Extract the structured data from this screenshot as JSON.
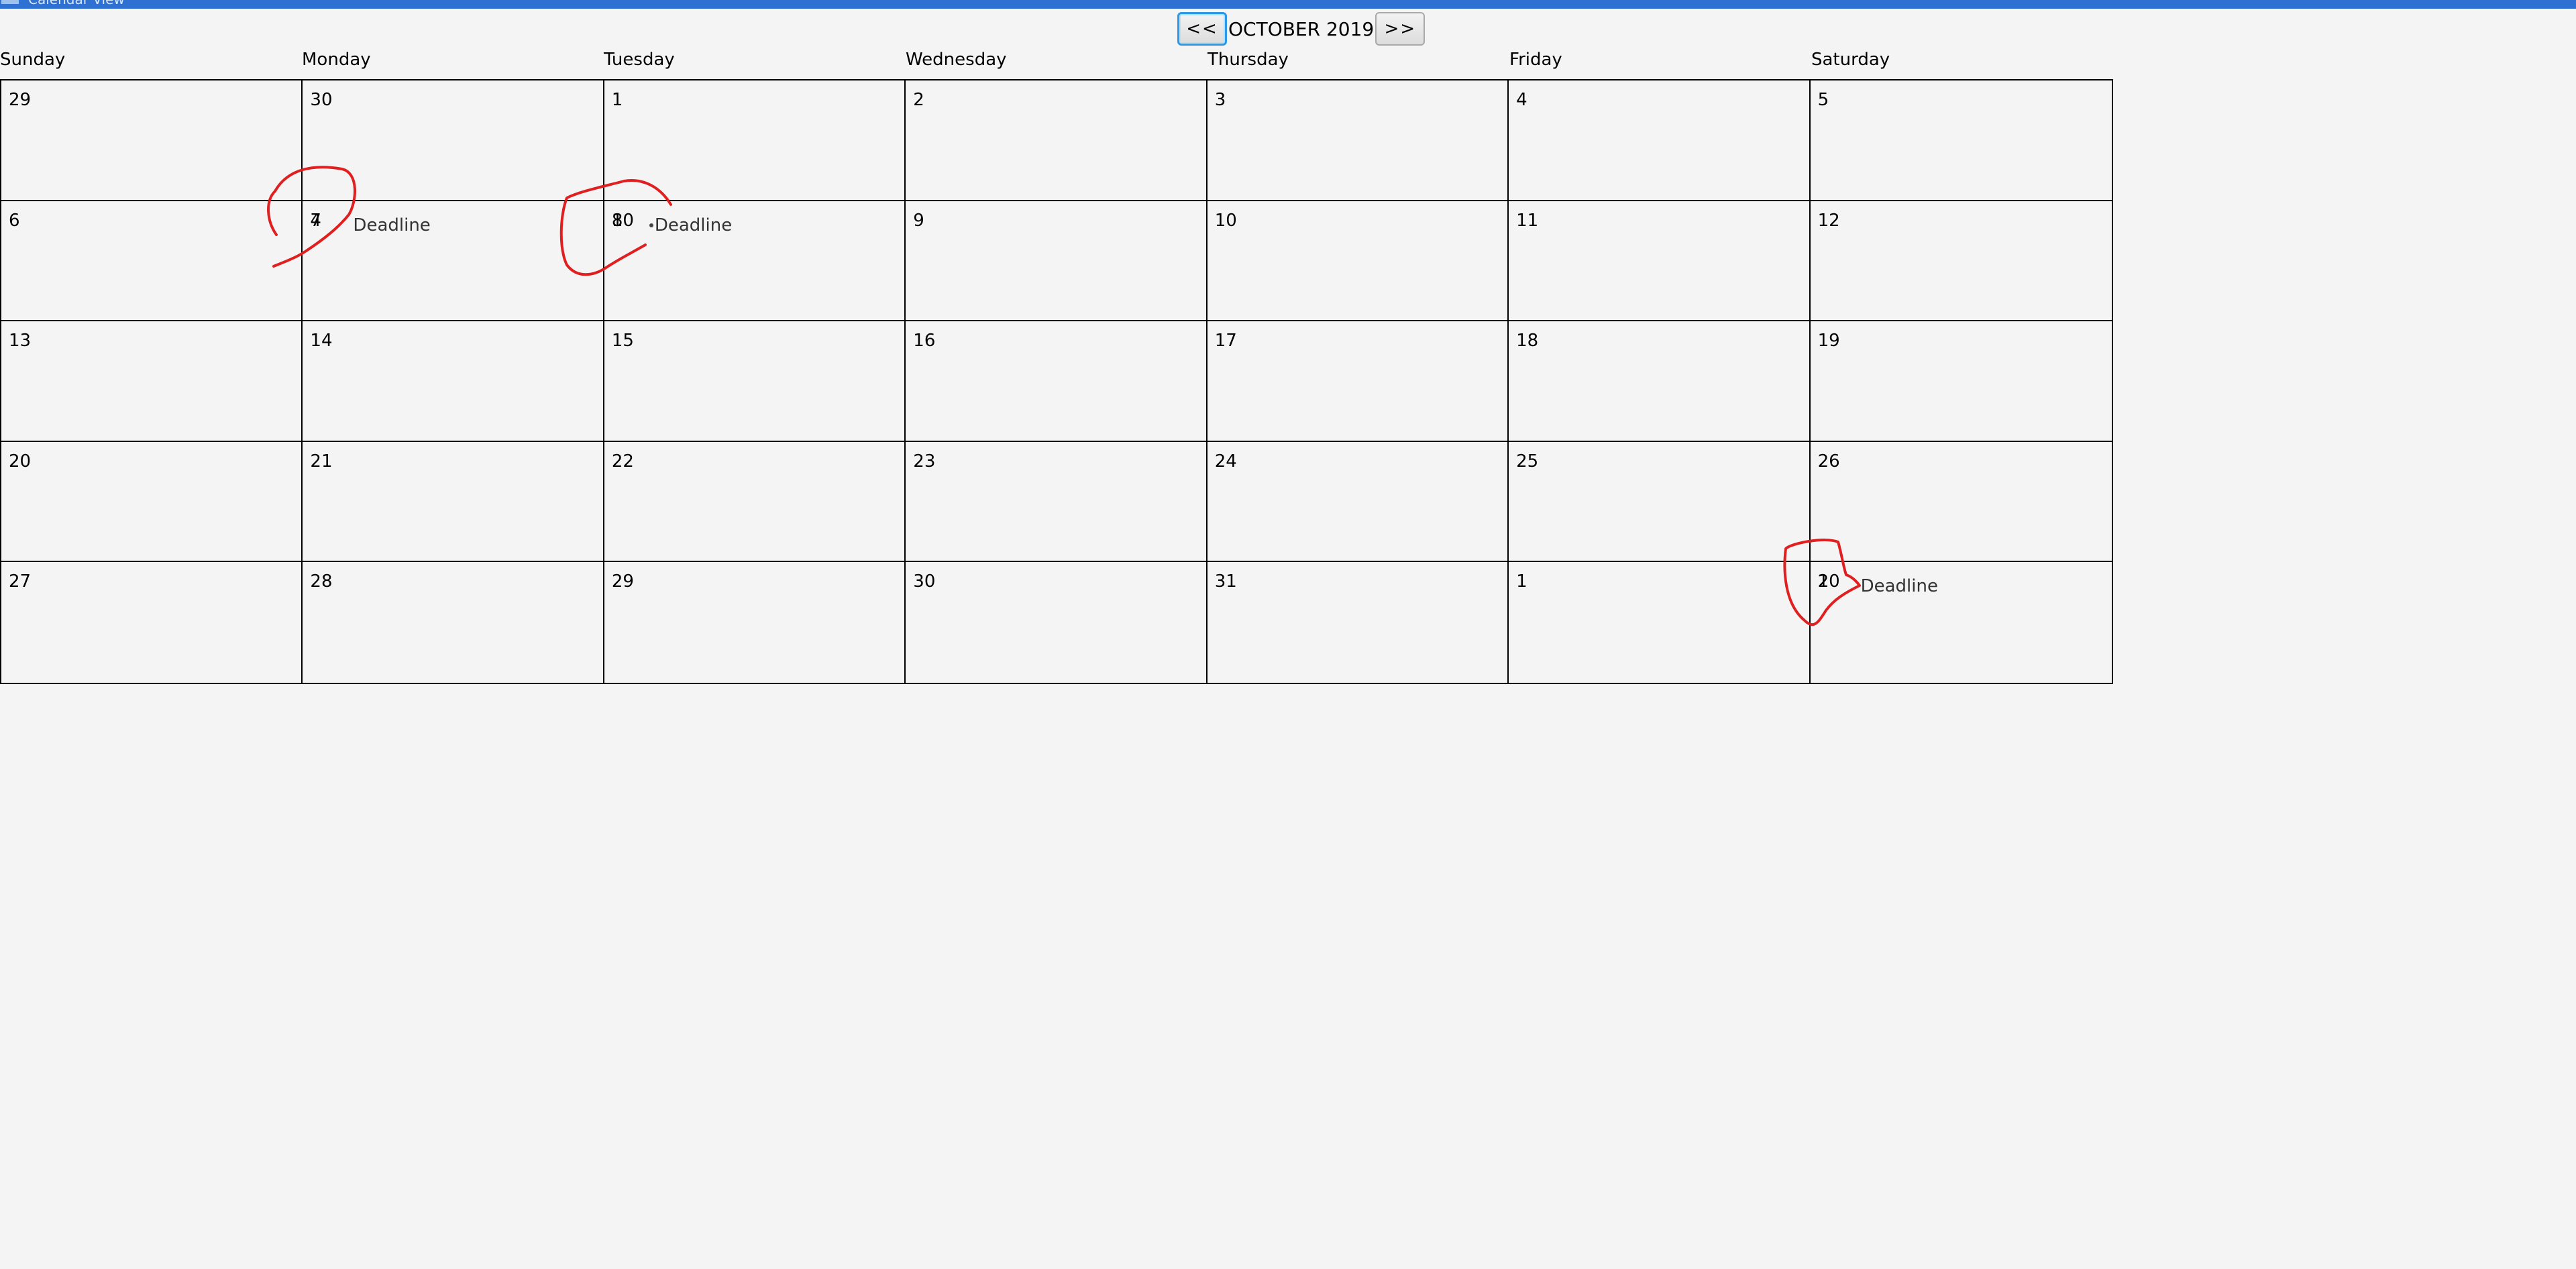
{
  "window": {
    "title": "Calendar View"
  },
  "nav": {
    "prev_label": "<<",
    "next_label": ">>",
    "month_label": "OCTOBER 2019"
  },
  "weekdays": [
    "Sunday",
    "Monday",
    "Tuesday",
    "Wednesday",
    "Thursday",
    "Friday",
    "Saturday"
  ],
  "weeks": [
    [
      "29",
      "30",
      "1",
      "2",
      "3",
      "4",
      "5"
    ],
    [
      "6",
      "7",
      "8",
      "9",
      "10",
      "11",
      "12"
    ],
    [
      "13",
      "14",
      "15",
      "16",
      "17",
      "18",
      "19"
    ],
    [
      "20",
      "21",
      "22",
      "23",
      "24",
      "25",
      "26"
    ],
    [
      "27",
      "28",
      "29",
      "30",
      "31",
      "1",
      "2"
    ]
  ],
  "overlap_numbers": {
    "w1_mon": "4",
    "w1_tue": "10",
    "w4_sat": "10"
  },
  "events": {
    "w1_mon": "Deadline",
    "w1_tue": "Deadline",
    "w4_sat": "Deadline"
  },
  "colors": {
    "titlebar": "#2e71d2",
    "annotation": "#e02020",
    "focus": "#2a9ae8"
  }
}
